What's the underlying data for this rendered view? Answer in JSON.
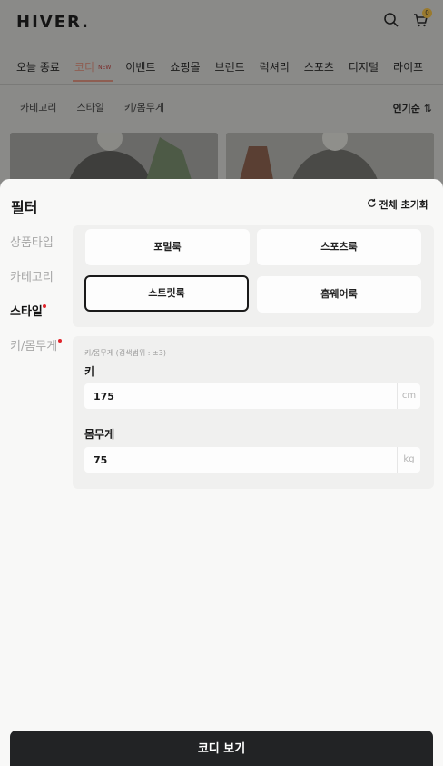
{
  "app": {
    "logo": "HIVER.",
    "cart_count": "0"
  },
  "nav": {
    "items": [
      "오늘 종료",
      "코디",
      "이벤트",
      "쇼핑몰",
      "브랜드",
      "럭셔리",
      "스포츠",
      "디지털",
      "라이프"
    ],
    "new_tag": "NEW"
  },
  "subnav": {
    "items": [
      "카테고리",
      "스타일",
      "키/몸무게"
    ],
    "sort_label": "인기순"
  },
  "filter": {
    "title": "필터",
    "reset_label": "전체 초기화",
    "side_items": [
      "상품타입",
      "카테고리",
      "스타일",
      "키/몸무게"
    ],
    "style_options": [
      "포멀룩",
      "스포츠룩",
      "스트릿룩",
      "홈웨어룩"
    ],
    "selected_style": "스트릿룩",
    "size_hint": "키/몸무게 (검색범위 : ±3)",
    "height_label": "키",
    "height_value": "175",
    "height_unit": "cm",
    "weight_label": "몸무게",
    "weight_value": "75",
    "weight_unit": "kg"
  },
  "cta": {
    "label": "코디 보기"
  },
  "colors": {
    "accent": "#8e5e52",
    "dark": "#222325",
    "dot": "#e0242b"
  }
}
